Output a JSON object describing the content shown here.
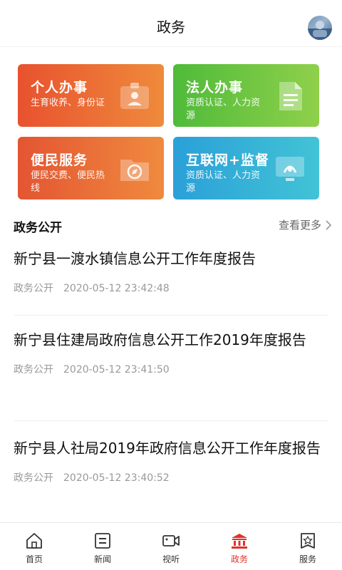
{
  "header": {
    "title": "政务"
  },
  "services": [
    {
      "title": "个人办事",
      "subtitle": "生育收养、身份证",
      "icon": "id-card-icon"
    },
    {
      "title": "法人办事",
      "subtitle": "资质认证、人力资源",
      "icon": "document-icon"
    },
    {
      "title": "便民服务",
      "subtitle": "便民交费、便民热线",
      "icon": "compass-folder-icon"
    },
    {
      "title": "互联网+监督",
      "subtitle": "资质认证、人力资源",
      "icon": "monitor-icon"
    }
  ],
  "section": {
    "title": "政务公开",
    "more_label": "查看更多"
  },
  "news": [
    {
      "title": "新宁县一渡水镇信息公开工作年度报告",
      "source": "政务公开",
      "time": "2020-05-12 23:42:48"
    },
    {
      "title": "新宁县住建局政府信息公开工作2019年度报告",
      "source": "政务公开",
      "time": "2020-05-12 23:41:50"
    },
    {
      "title": "新宁县人社局2019年政府信息公开工作年度报告",
      "source": "政务公开",
      "time": "2020-05-12 23:40:52"
    }
  ],
  "tabs": [
    {
      "label": "首页",
      "icon": "home-icon"
    },
    {
      "label": "新闻",
      "icon": "news-icon"
    },
    {
      "label": "视听",
      "icon": "video-icon"
    },
    {
      "label": "政务",
      "icon": "government-icon",
      "active": true
    },
    {
      "label": "服务",
      "icon": "service-icon"
    }
  ],
  "colors": {
    "accent": "#e0322b",
    "card_orange": "#e8522f",
    "card_green": "#4fbb3a",
    "card_blue": "#2aa0d8"
  }
}
